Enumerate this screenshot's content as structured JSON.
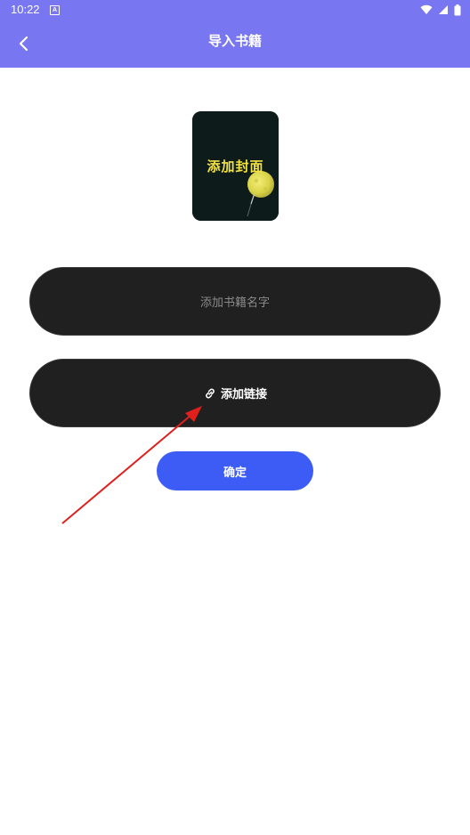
{
  "status_bar": {
    "time": "10:22",
    "notification_icon": "a-letter-icon",
    "icons": [
      "wifi-icon",
      "signal-icon",
      "battery-icon"
    ]
  },
  "header": {
    "title": "导入书籍",
    "back_icon": "chevron-left-icon",
    "background_color": "#7876f0"
  },
  "cover": {
    "label": "添加封面"
  },
  "name_field": {
    "placeholder": "添加书籍名字",
    "value": ""
  },
  "link_field": {
    "icon": "link-icon",
    "label": "添加链接"
  },
  "confirm_button": {
    "label": "确定",
    "color": "#3c5cf5"
  },
  "annotation": {
    "type": "red-arrow",
    "color": "#e0201c"
  }
}
